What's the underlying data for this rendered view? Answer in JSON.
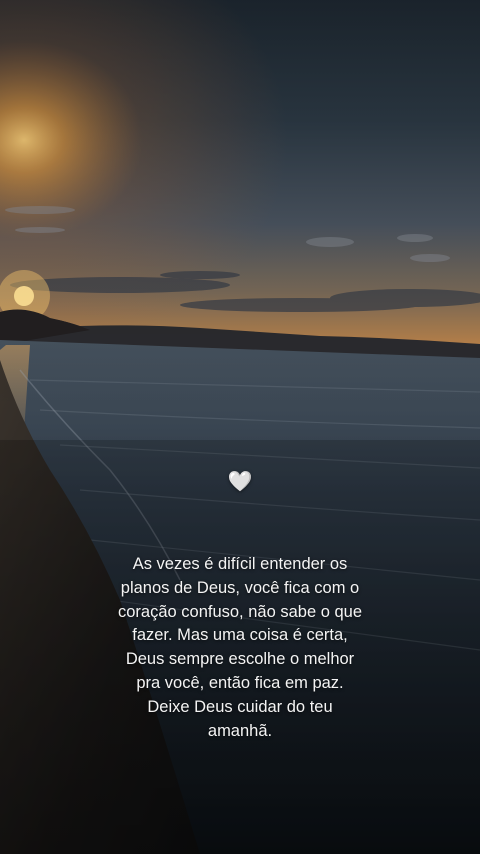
{
  "colors": {
    "sky_top": "#27313d",
    "sky_mid": "#3b4a57",
    "horizon_glow": "#e49a3c",
    "sun": "#ffd27a",
    "water": "#2b3642",
    "text": "#f4f4f4"
  },
  "overlay": {
    "heart_icon": "white-heart-icon",
    "heart_glyph": "🤍",
    "quote_lines": [
      "As vezes é difícil entender os",
      "planos de Deus, você fica com o",
      "coração confuso, não sabe o que",
      "fazer. Mas uma coisa é certa,",
      "Deus sempre escolhe o melhor",
      "pra você, então fica em paz.",
      "Deixe Deus cuidar do teu",
      "amanhã."
    ]
  }
}
